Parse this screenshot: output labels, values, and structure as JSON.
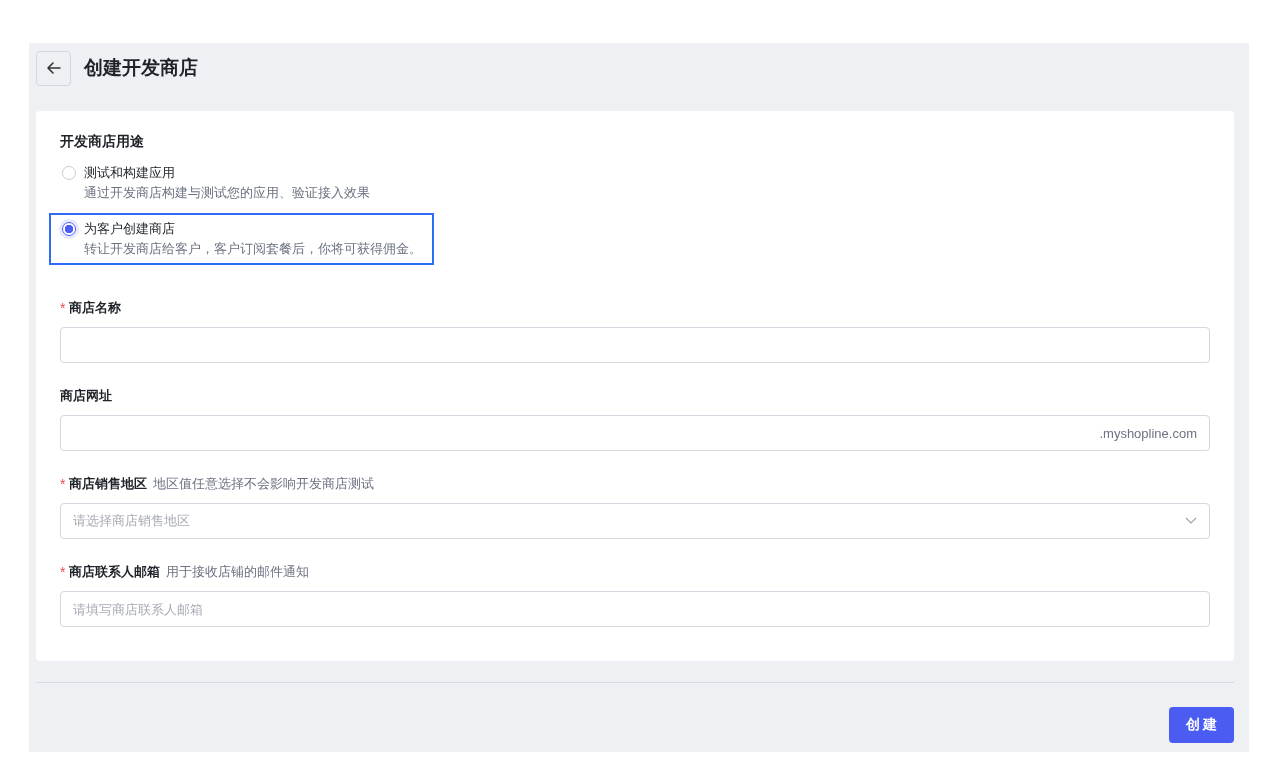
{
  "page": {
    "title": "创建开发商店"
  },
  "purpose": {
    "label": "开发商店用途",
    "options": [
      {
        "title": "测试和构建应用",
        "description": "通过开发商店构建与测试您的应用、验证接入效果",
        "selected": false
      },
      {
        "title": "为客户创建商店",
        "description": "转让开发商店给客户，客户订阅套餐后，你将可获得佣金。",
        "selected": true
      }
    ]
  },
  "fields": [
    {
      "kind": "text",
      "label": "商店名称",
      "required_mark": "*"
    },
    {
      "kind": "suffix",
      "label": "商店网址",
      "suffix": ".myshopline.com"
    },
    {
      "kind": "select",
      "label": "商店销售地区",
      "required_mark": "*",
      "hint": "地区值任意选择不会影响开发商店测试",
      "placeholder": "请选择商店销售地区"
    },
    {
      "kind": "text",
      "label": "商店联系人邮箱",
      "required_mark": "*",
      "hint": "用于接收店铺的邮件通知",
      "placeholder": "请填写商店联系人邮箱"
    }
  ],
  "actions": {
    "submit": "创 建"
  }
}
